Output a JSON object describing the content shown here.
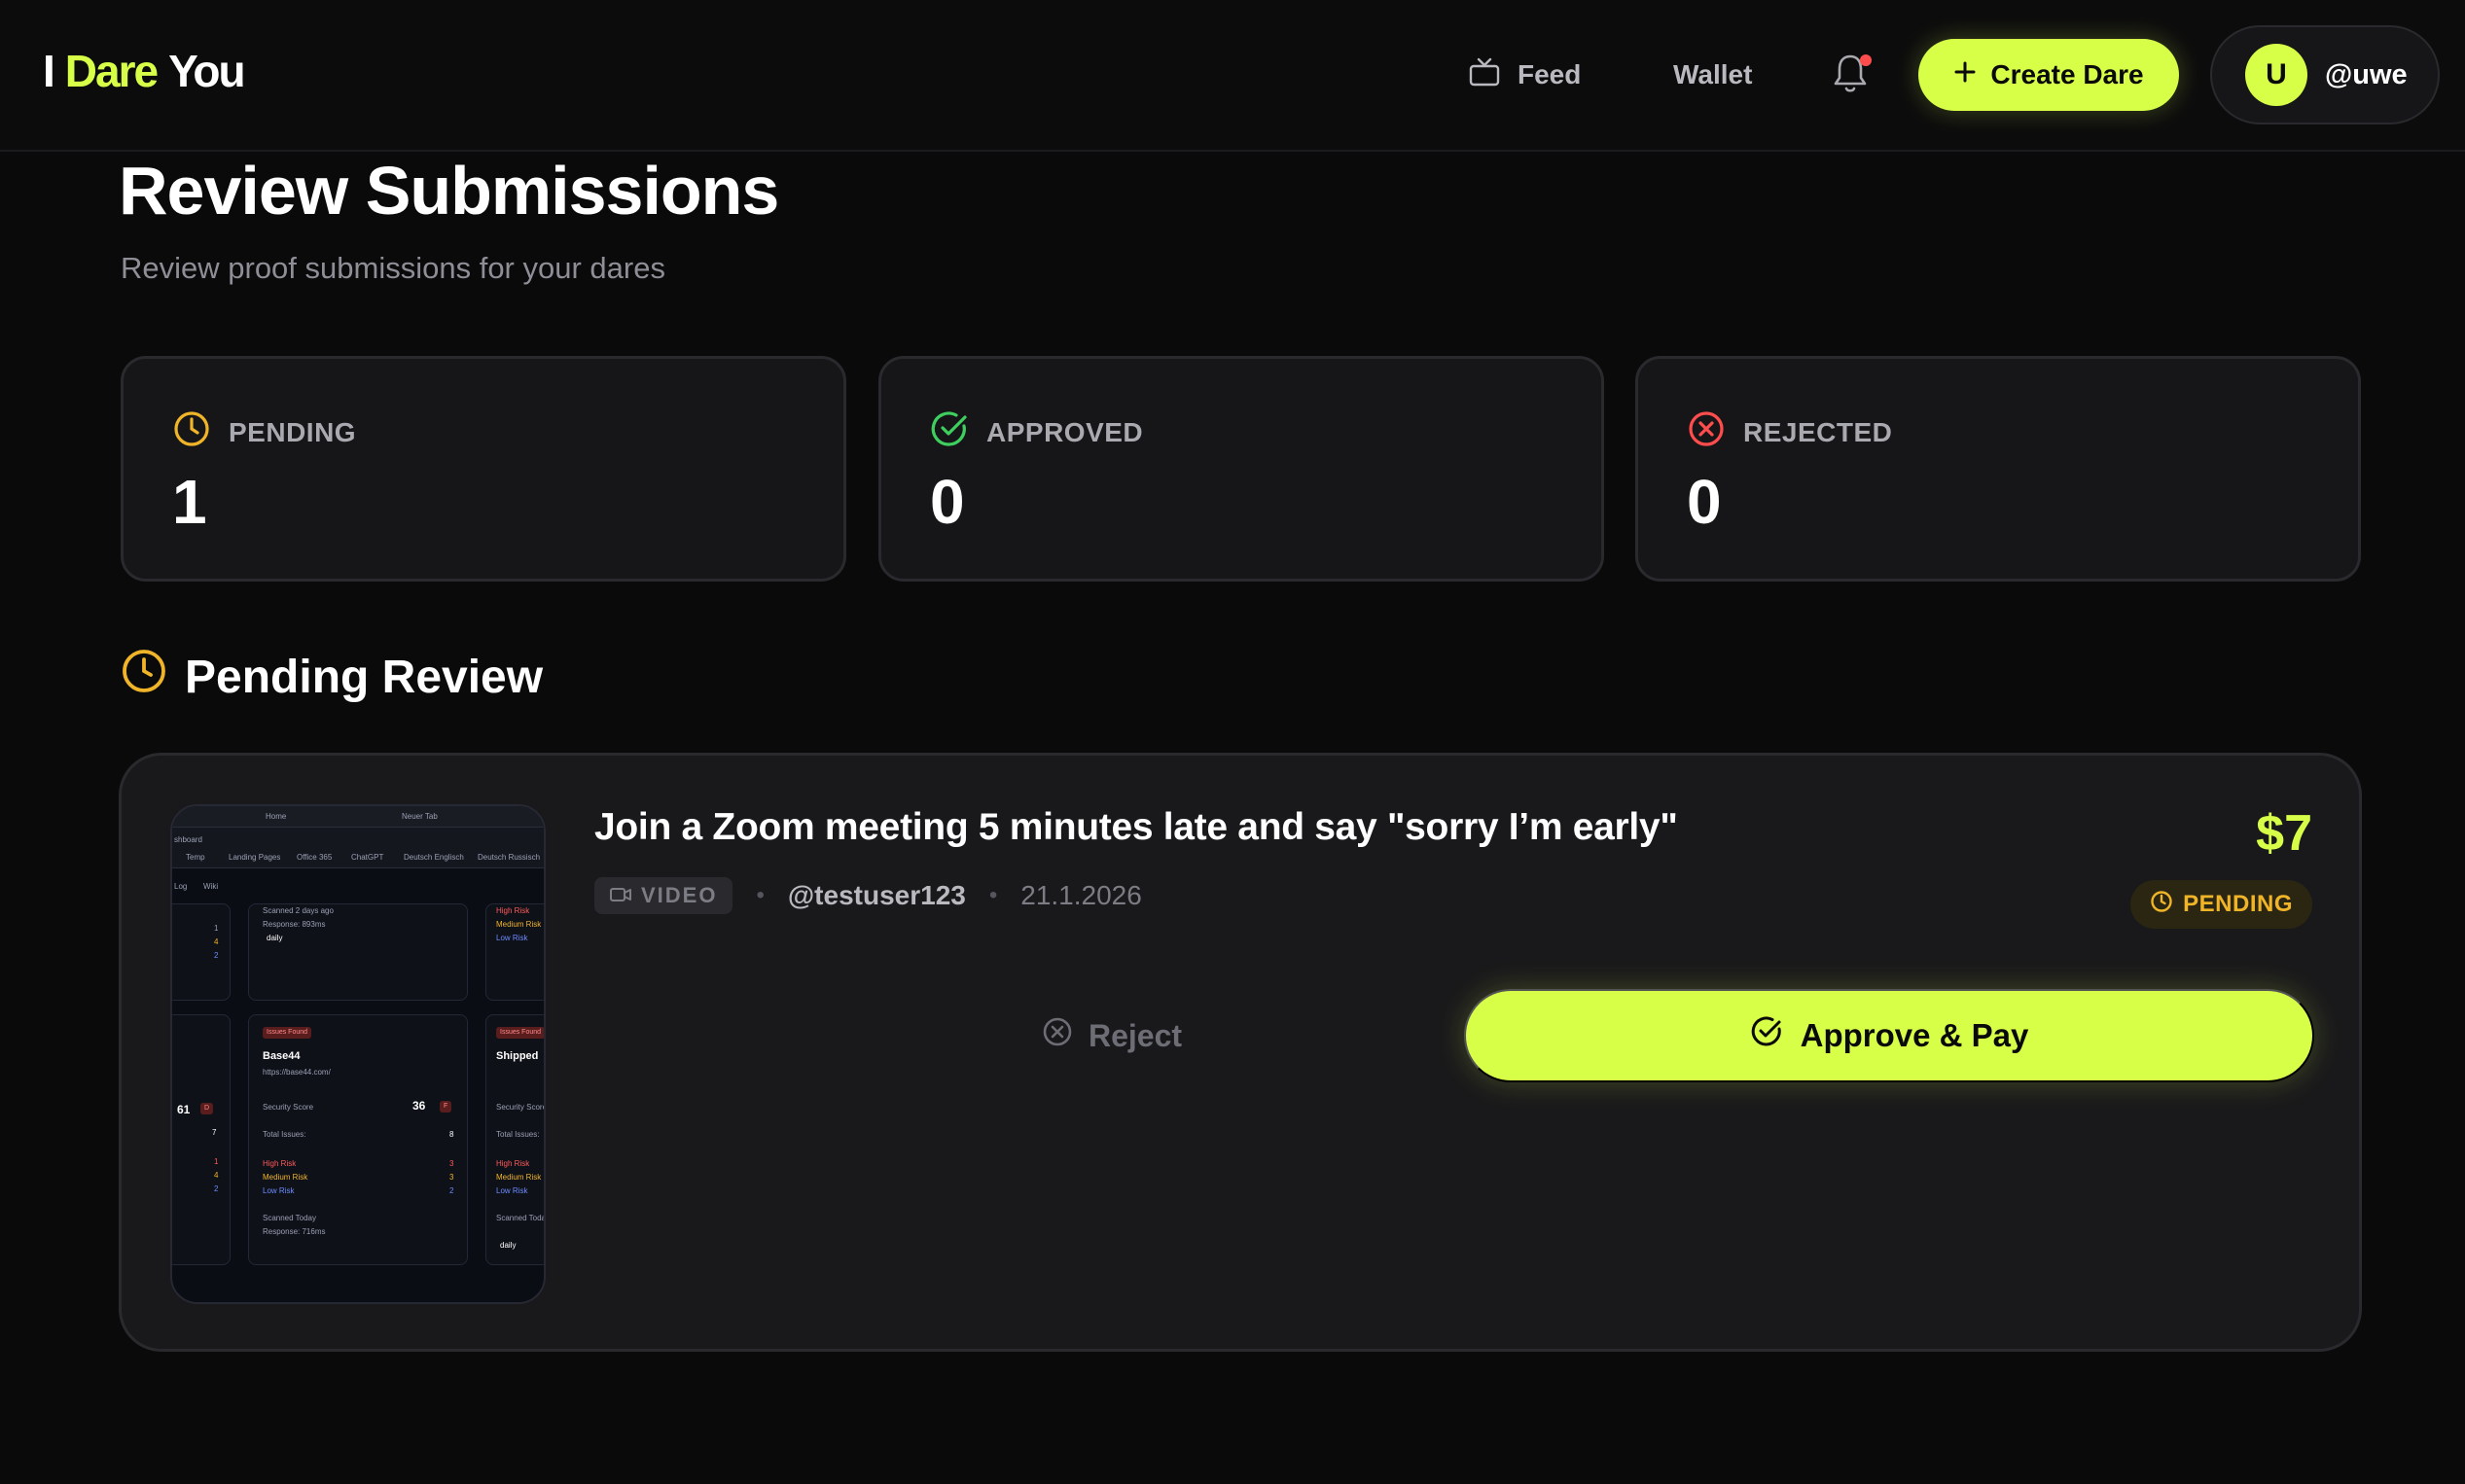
{
  "nav": {
    "logo": [
      "I",
      "Dare",
      "You"
    ],
    "feed_label": "Feed",
    "wallet_label": "Wallet",
    "create_label": "Create Dare",
    "avatar_initial": "U",
    "user_handle": "@uwe"
  },
  "header": {
    "title": "Review Submissions",
    "subtitle": "Review proof submissions for your dares"
  },
  "stats": {
    "pending_label": "PENDING",
    "pending_value": "1",
    "approved_label": "APPROVED",
    "approved_value": "0",
    "rejected_label": "REJECTED",
    "rejected_value": "0"
  },
  "section": {
    "title": "Pending Review"
  },
  "submission": {
    "title": "Join a Zoom meeting 5 minutes late and say \"sorry I’m early\"",
    "type": "VIDEO",
    "user": "@testuser123",
    "date": "21.1.2026",
    "amount": "$7",
    "status": "PENDING",
    "reject_label": "Reject",
    "approve_label": "Approve & Pay",
    "thumbnail": {
      "tab_home": "Home",
      "tab_new": "Neuer Tab",
      "nav_dashboard": "shboard",
      "bookmarks": [
        "Temp",
        "Landing Pages",
        "Office 365",
        "ChatGPT",
        "Deutsch Englisch",
        "Deutsch Russisch"
      ],
      "menu": [
        "Log",
        "Wiki"
      ],
      "scanned_ago": "Scanned 2 days ago",
      "response_1": "Response: 893ms",
      "daily": "daily",
      "issues_found": "Issues Found",
      "site_name": "Base44",
      "site_url": "https://base44.com/",
      "security_score_label": "Security Score",
      "security_score": "36",
      "grade": "F",
      "total_issues_label": "Total Issues:",
      "total_issues": "8",
      "high_risk": "High Risk",
      "high_count": "3",
      "medium_risk": "Medium Risk",
      "medium_count": "3",
      "low_risk": "Low Risk",
      "low_count": "2",
      "scanned_today": "Scanned Today",
      "response_2": "Response: 716ms",
      "left_score": "61",
      "left_grade": "D",
      "left_total": "7",
      "right_name": "Shipped",
      "left_counts": [
        "1",
        "4",
        "2"
      ],
      "left_bottom_counts": [
        "1",
        "4",
        "2"
      ]
    }
  },
  "colors": {
    "accent": "#d8ff48",
    "pending": "#f0b429",
    "approved": "#3ecf5e",
    "rejected": "#ff4d4d",
    "background": "#0a0a0b",
    "card": "#161618"
  }
}
